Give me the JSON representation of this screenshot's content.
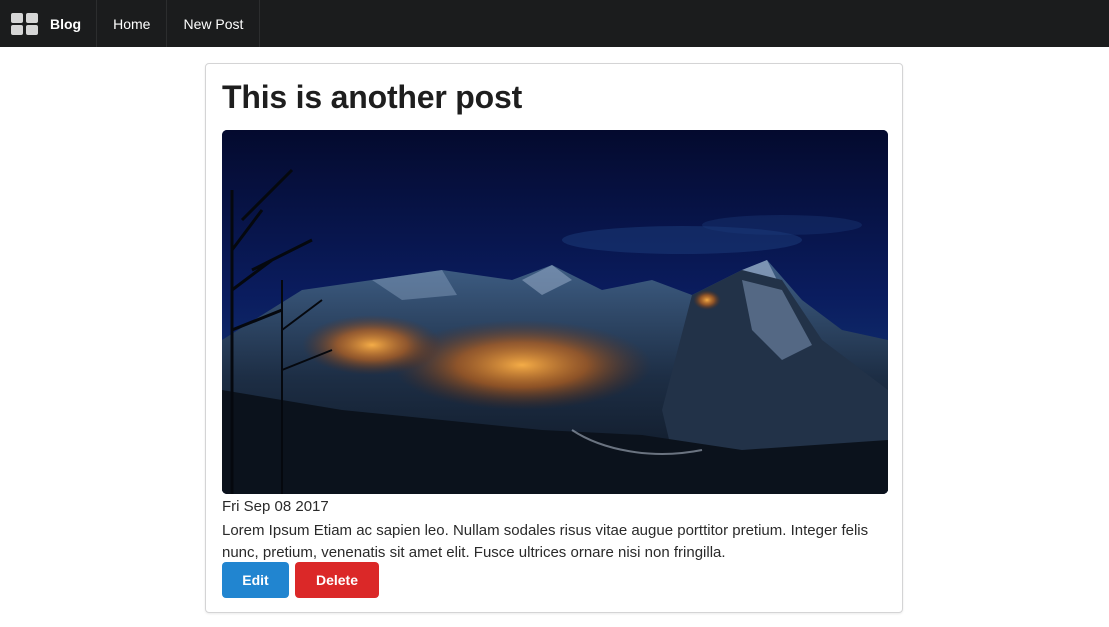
{
  "nav": {
    "brand_label": "Blog",
    "items": [
      {
        "label": "Home"
      },
      {
        "label": "New Post"
      }
    ],
    "brand_icon": "grid-icon",
    "background": "#1b1c1d"
  },
  "post": {
    "title": "This is another post",
    "image_description_icon": "mountain-village-night-photo",
    "date": "Fri Sep 08 2017",
    "body": "Lorem Ipsum Etiam ac sapien leo. Nullam sodales risus vitae augue porttitor pretium. Integer felis nunc, pretium, venenatis sit amet elit. Fusce ultrices ornare nisi non fringilla.",
    "actions": {
      "edit_label": "Edit",
      "delete_label": "Delete"
    }
  },
  "colors": {
    "edit_button": "#2185d0",
    "delete_button": "#db2828"
  }
}
